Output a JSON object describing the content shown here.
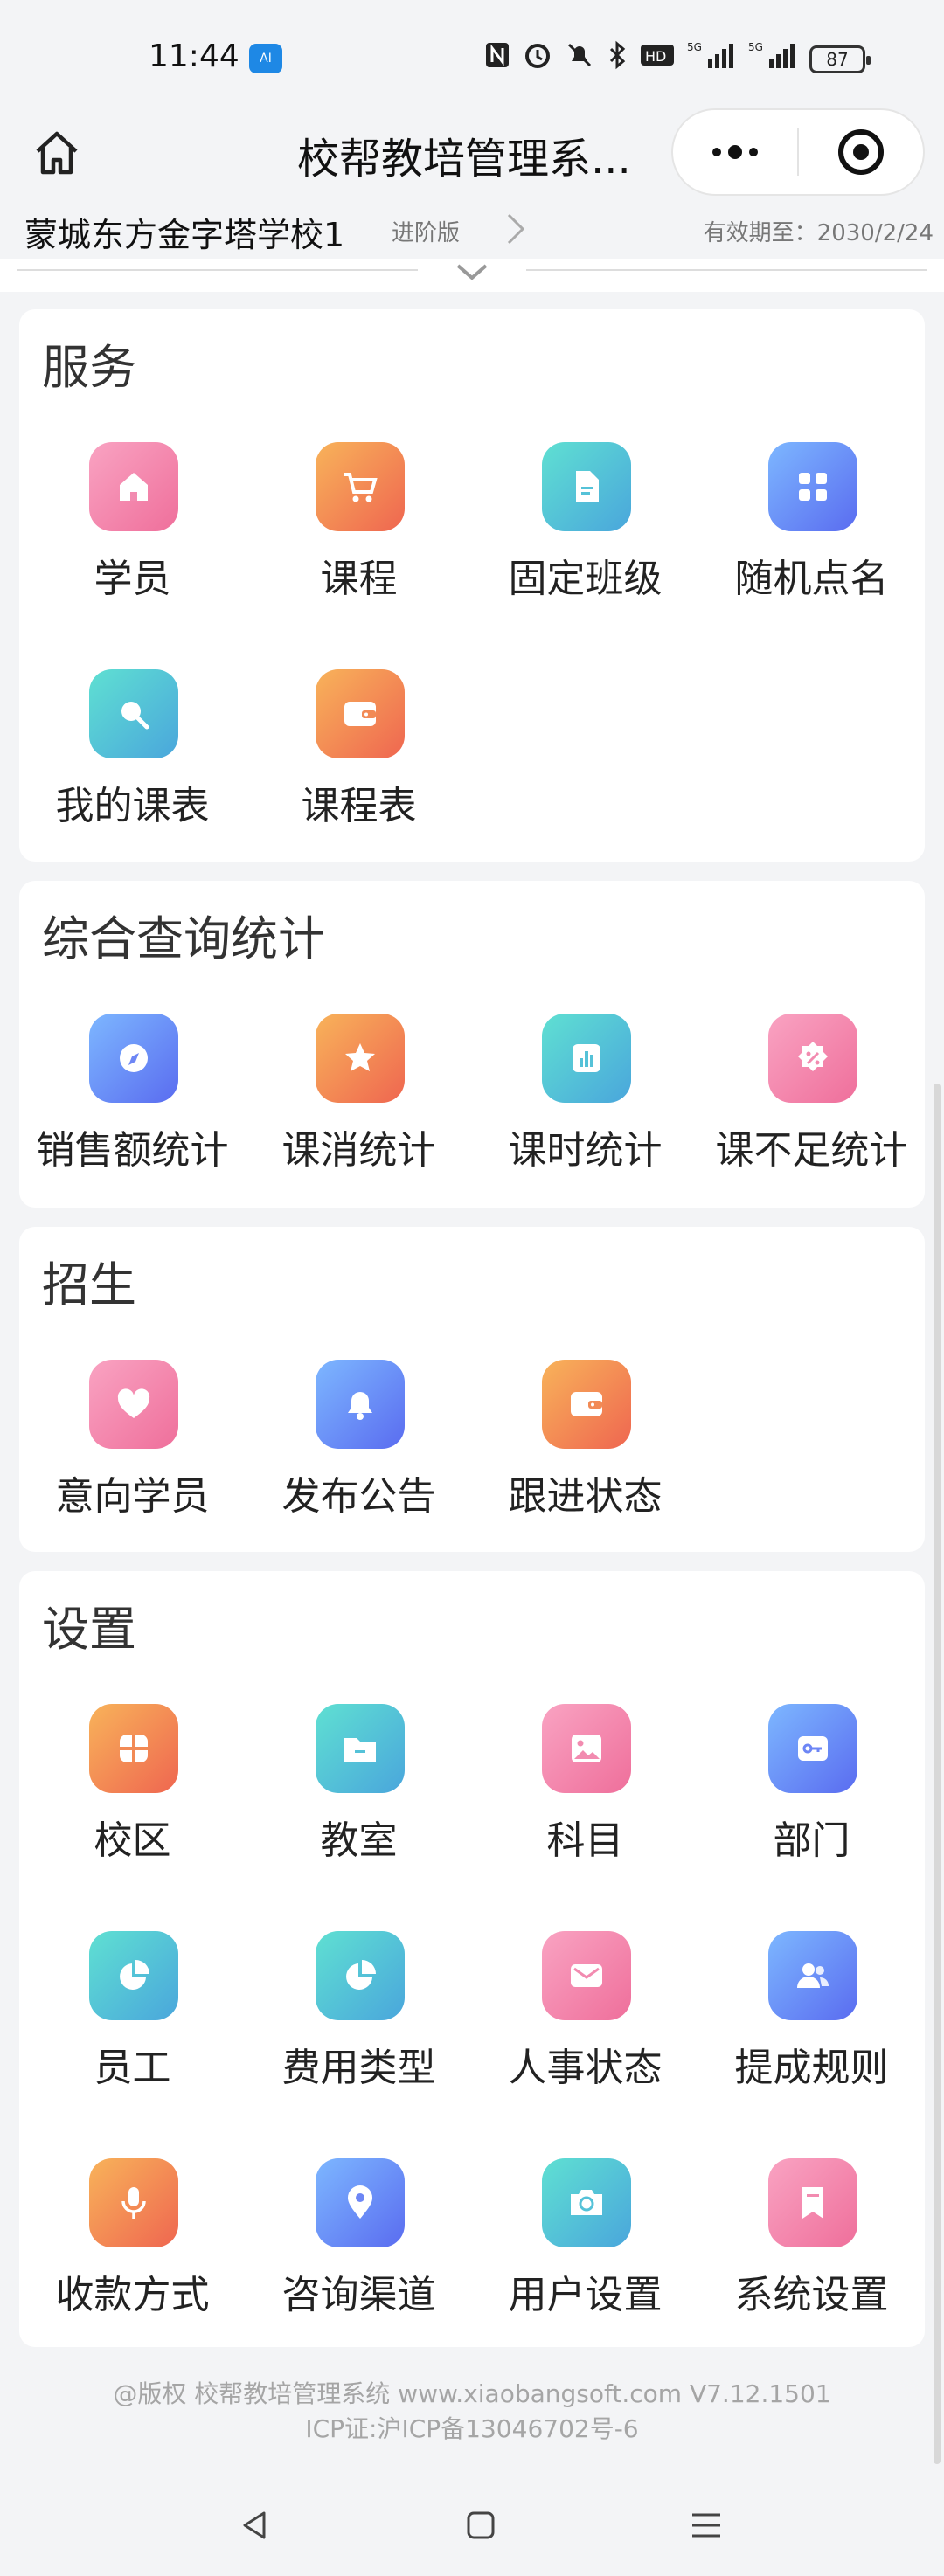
{
  "status": {
    "time": "11:44",
    "app_badge": "AI",
    "icons": [
      "nfc-icon",
      "alarm-icon",
      "mute-icon",
      "bluetooth-icon",
      "hd-icon",
      "signal-5g-icon",
      "signal-5g-icon"
    ],
    "battery": "87"
  },
  "nav": {
    "title": "校帮教培管理系...",
    "home_icon": "home-icon"
  },
  "school": {
    "name": "蒙城东方金字塔学校1",
    "tier": "进阶版",
    "expiry": "有效期至：2030/2/24"
  },
  "sections": {
    "service": {
      "title": "服务",
      "items": [
        {
          "label": "学员",
          "icon": "home-icon",
          "color": "pink"
        },
        {
          "label": "课程",
          "icon": "cart-icon",
          "color": "orange"
        },
        {
          "label": "固定班级",
          "icon": "document-icon",
          "color": "teal"
        },
        {
          "label": "随机点名",
          "icon": "grid-icon",
          "color": "blue"
        },
        {
          "label": "我的课表",
          "icon": "search-icon",
          "color": "teal"
        },
        {
          "label": "课程表",
          "icon": "wallet-icon",
          "color": "orange"
        }
      ]
    },
    "stats": {
      "title": "综合查询统计",
      "items": [
        {
          "label": "销售额统计",
          "icon": "compass-icon",
          "color": "blue"
        },
        {
          "label": "课消统计",
          "icon": "star-icon",
          "color": "orange"
        },
        {
          "label": "课时统计",
          "icon": "bar-chart-icon",
          "color": "teal"
        },
        {
          "label": "课不足统计",
          "icon": "discount-badge-icon",
          "color": "pink"
        }
      ]
    },
    "enroll": {
      "title": "招生",
      "items": [
        {
          "label": "意向学员",
          "icon": "heart-icon",
          "color": "pink"
        },
        {
          "label": "发布公告",
          "icon": "bell-icon",
          "color": "blue"
        },
        {
          "label": "跟进状态",
          "icon": "wallet-icon",
          "color": "orange"
        }
      ]
    },
    "settings": {
      "title": "设置",
      "items": [
        {
          "label": "校区",
          "icon": "campus-icon",
          "color": "orange"
        },
        {
          "label": "教室",
          "icon": "folder-icon",
          "color": "teal"
        },
        {
          "label": "科目",
          "icon": "image-icon",
          "color": "pink"
        },
        {
          "label": "部门",
          "icon": "key-icon",
          "color": "blue"
        },
        {
          "label": "员工",
          "icon": "pie-chart-icon",
          "color": "teal"
        },
        {
          "label": "费用类型",
          "icon": "pie-chart-icon",
          "color": "teal"
        },
        {
          "label": "人事状态",
          "icon": "mail-icon",
          "color": "pink"
        },
        {
          "label": "提成规则",
          "icon": "users-icon",
          "color": "blue"
        },
        {
          "label": "收款方式",
          "icon": "microphone-icon",
          "color": "orange"
        },
        {
          "label": "咨询渠道",
          "icon": "location-pin-icon",
          "color": "blue"
        },
        {
          "label": "用户设置",
          "icon": "camera-icon",
          "color": "teal"
        },
        {
          "label": "系统设置",
          "icon": "bookmark-icon",
          "color": "pink"
        }
      ]
    }
  },
  "footer": {
    "line1": "@版权 校帮教培管理系统 www.xiaobangsoft.com V7.12.1501",
    "line2": "ICP证:沪ICP备13046702号-6"
  },
  "system_nav": {
    "back_icon": "back-triangle-icon",
    "home_icon": "home-square-icon",
    "menu_icon": "menu-lines-icon"
  }
}
